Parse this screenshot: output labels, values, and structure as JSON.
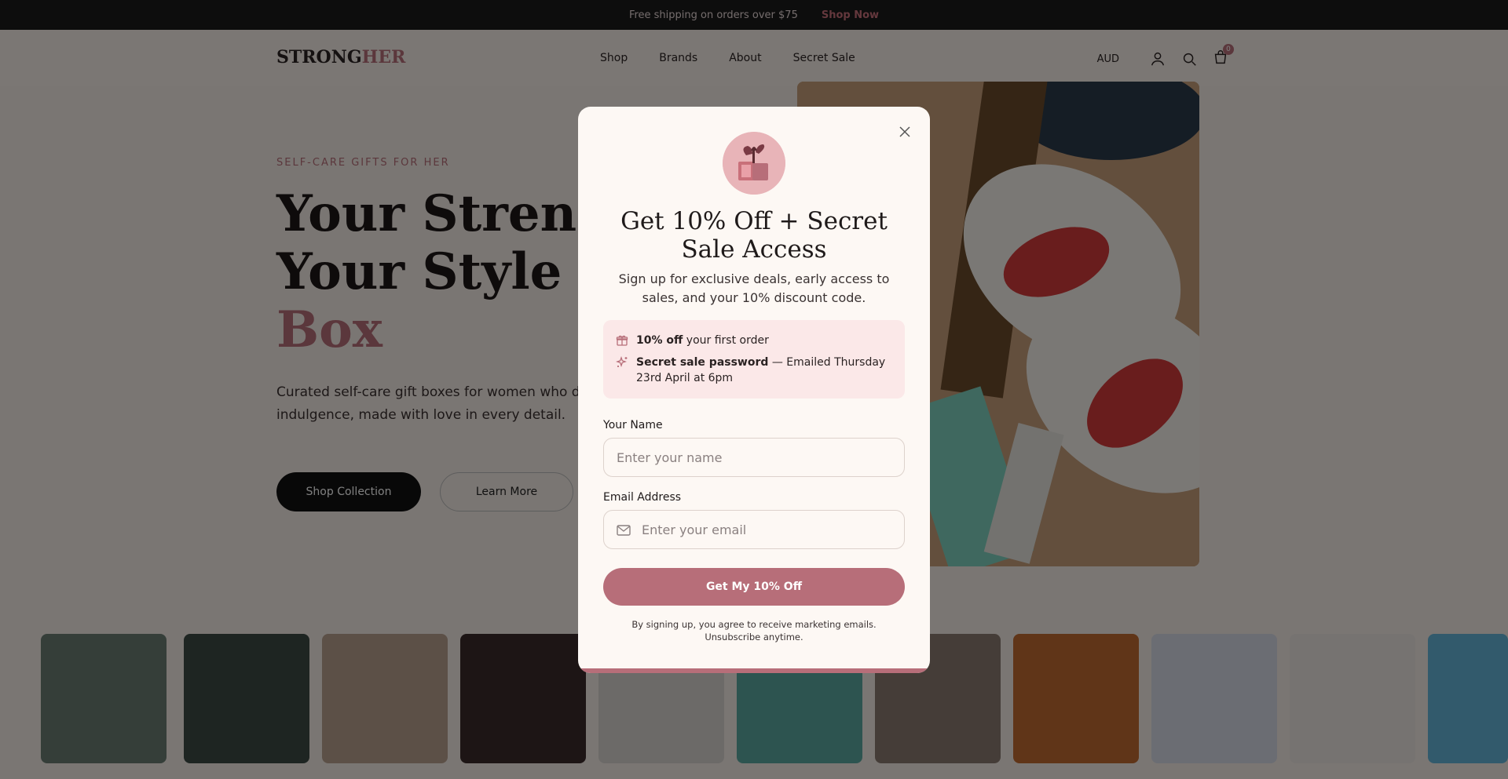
{
  "topbar": {
    "promo_text": "Free shipping on orders over $75",
    "promo_link": "Shop Now"
  },
  "header": {
    "logo_main": "STRONG",
    "logo_accent": "HER",
    "nav": [
      "Shop",
      "Brands",
      "About",
      "Secret Sale"
    ],
    "currency": "AUD",
    "cart_count": "0"
  },
  "hero": {
    "eyebrow": "SELF-CARE GIFTS FOR HER",
    "title_line1": "Your Strength,",
    "title_line2": "Your Style – In",
    "title_accent": "Box",
    "subtitle": "Curated self-care gift boxes for women who deserve a little indulgence, made with love in every detail.",
    "primary_cta": "Shop Collection",
    "secondary_cta": "Learn More"
  },
  "modal": {
    "title": "Get 10% Off + Secret Sale Access",
    "subtitle": "Sign up for exclusive deals, early access to sales, and your 10% discount code.",
    "perks": [
      {
        "bold": "10% off",
        "rest": " your first order",
        "icon": "gift-icon"
      },
      {
        "bold": "Secret sale password",
        "rest": " — Emailed Thursday 23rd April at 6pm",
        "icon": "sparkle-icon"
      }
    ],
    "name_label": "Your Name",
    "name_placeholder": "Enter your name",
    "name_value": "",
    "email_label": "Email Address",
    "email_placeholder": "Enter your email",
    "email_value": "",
    "submit_label": "Get My 10% Off",
    "disclaimer": "By signing up, you agree to receive marketing emails. Unsubscribe anytime."
  },
  "colors": {
    "accent": "#b76e79",
    "modal_bg": "#fdf8f4",
    "perk_bg": "#fbe8e8",
    "overlay": "rgba(0,0,0,0.5)"
  }
}
